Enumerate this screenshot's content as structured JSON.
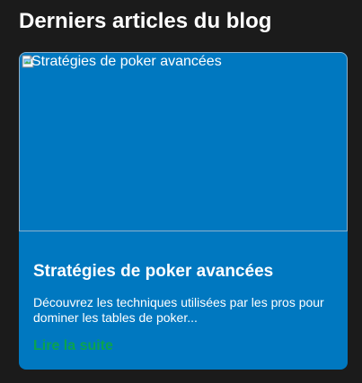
{
  "section": {
    "title": "Derniers articles du blog"
  },
  "articles": [
    {
      "image_alt": "Stratégies de poker avancées",
      "title": "Stratégies de poker avancées",
      "excerpt": "Découvrez les techniques utilisées par les pros pour dominer les tables de poker...",
      "link_label": "Lire la suite"
    }
  ],
  "colors": {
    "background": "#1b1b1b",
    "card": "#0078c0",
    "link": "#0aa34f",
    "text": "#ffffff"
  },
  "icons": {
    "broken_image": "broken-image-icon"
  }
}
